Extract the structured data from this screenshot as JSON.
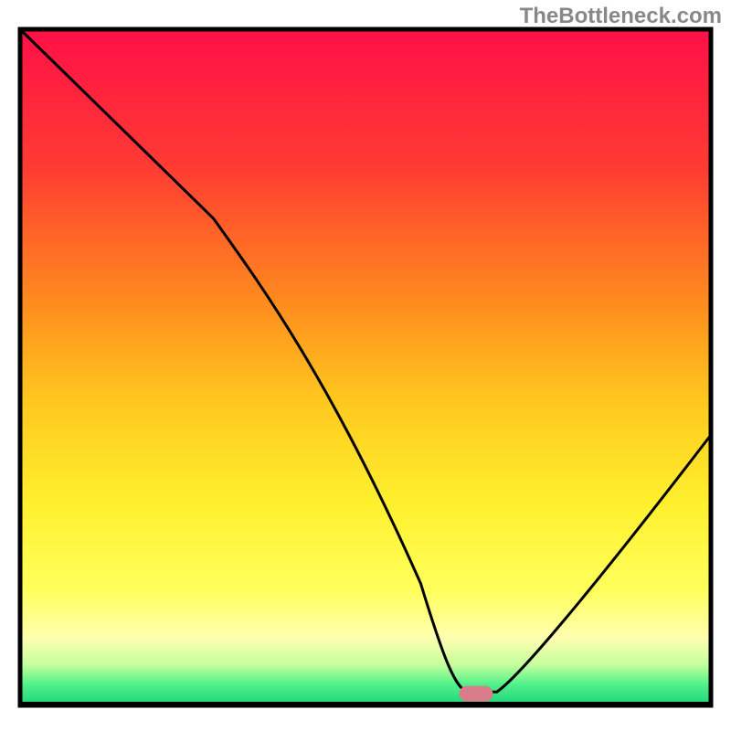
{
  "watermark": "TheBottleneck.com",
  "chart_data": {
    "type": "line",
    "title": "",
    "xlabel": "",
    "ylabel": "",
    "xlim": [
      0,
      100
    ],
    "ylim": [
      0,
      100
    ],
    "x": [
      0,
      15,
      30,
      45,
      60,
      65,
      70,
      85,
      100
    ],
    "y": [
      100,
      85,
      72,
      50,
      20,
      2,
      2,
      20,
      40
    ],
    "marker_x": 66,
    "marker_y": 2,
    "gradient_stops": [
      {
        "offset": 0,
        "color": "#ff1047"
      },
      {
        "offset": 20,
        "color": "#ff3a33"
      },
      {
        "offset": 40,
        "color": "#ff8a1e"
      },
      {
        "offset": 55,
        "color": "#ffc81f"
      },
      {
        "offset": 70,
        "color": "#fff02d"
      },
      {
        "offset": 83,
        "color": "#ffff5c"
      },
      {
        "offset": 90,
        "color": "#ffffb0"
      },
      {
        "offset": 94,
        "color": "#c4ff9c"
      },
      {
        "offset": 97,
        "color": "#4df08a"
      },
      {
        "offset": 100,
        "color": "#1cd47a"
      }
    ],
    "series_color": "#000000",
    "marker_fill": "#d97c8a",
    "marker_stroke": "#d97c8a"
  }
}
